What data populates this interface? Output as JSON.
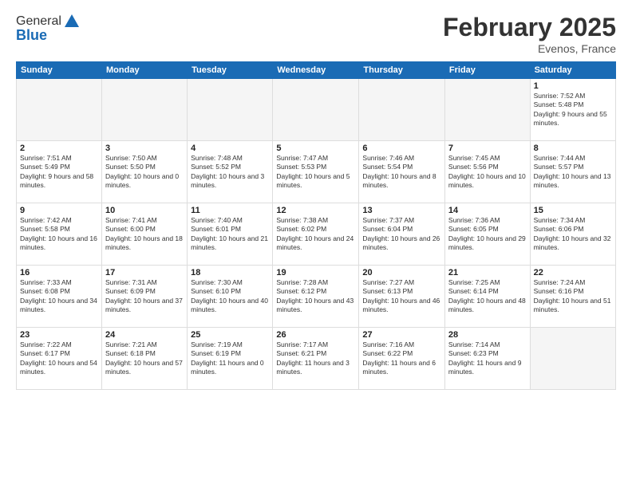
{
  "header": {
    "logo_line1": "General",
    "logo_line2": "Blue",
    "month": "February 2025",
    "location": "Evenos, France"
  },
  "weekdays": [
    "Sunday",
    "Monday",
    "Tuesday",
    "Wednesday",
    "Thursday",
    "Friday",
    "Saturday"
  ],
  "weeks": [
    [
      {
        "day": "",
        "info": ""
      },
      {
        "day": "",
        "info": ""
      },
      {
        "day": "",
        "info": ""
      },
      {
        "day": "",
        "info": ""
      },
      {
        "day": "",
        "info": ""
      },
      {
        "day": "",
        "info": ""
      },
      {
        "day": "1",
        "info": "Sunrise: 7:52 AM\nSunset: 5:48 PM\nDaylight: 9 hours and 55 minutes."
      }
    ],
    [
      {
        "day": "2",
        "info": "Sunrise: 7:51 AM\nSunset: 5:49 PM\nDaylight: 9 hours and 58 minutes."
      },
      {
        "day": "3",
        "info": "Sunrise: 7:50 AM\nSunset: 5:50 PM\nDaylight: 10 hours and 0 minutes."
      },
      {
        "day": "4",
        "info": "Sunrise: 7:48 AM\nSunset: 5:52 PM\nDaylight: 10 hours and 3 minutes."
      },
      {
        "day": "5",
        "info": "Sunrise: 7:47 AM\nSunset: 5:53 PM\nDaylight: 10 hours and 5 minutes."
      },
      {
        "day": "6",
        "info": "Sunrise: 7:46 AM\nSunset: 5:54 PM\nDaylight: 10 hours and 8 minutes."
      },
      {
        "day": "7",
        "info": "Sunrise: 7:45 AM\nSunset: 5:56 PM\nDaylight: 10 hours and 10 minutes."
      },
      {
        "day": "8",
        "info": "Sunrise: 7:44 AM\nSunset: 5:57 PM\nDaylight: 10 hours and 13 minutes."
      }
    ],
    [
      {
        "day": "9",
        "info": "Sunrise: 7:42 AM\nSunset: 5:58 PM\nDaylight: 10 hours and 16 minutes."
      },
      {
        "day": "10",
        "info": "Sunrise: 7:41 AM\nSunset: 6:00 PM\nDaylight: 10 hours and 18 minutes."
      },
      {
        "day": "11",
        "info": "Sunrise: 7:40 AM\nSunset: 6:01 PM\nDaylight: 10 hours and 21 minutes."
      },
      {
        "day": "12",
        "info": "Sunrise: 7:38 AM\nSunset: 6:02 PM\nDaylight: 10 hours and 24 minutes."
      },
      {
        "day": "13",
        "info": "Sunrise: 7:37 AM\nSunset: 6:04 PM\nDaylight: 10 hours and 26 minutes."
      },
      {
        "day": "14",
        "info": "Sunrise: 7:36 AM\nSunset: 6:05 PM\nDaylight: 10 hours and 29 minutes."
      },
      {
        "day": "15",
        "info": "Sunrise: 7:34 AM\nSunset: 6:06 PM\nDaylight: 10 hours and 32 minutes."
      }
    ],
    [
      {
        "day": "16",
        "info": "Sunrise: 7:33 AM\nSunset: 6:08 PM\nDaylight: 10 hours and 34 minutes."
      },
      {
        "day": "17",
        "info": "Sunrise: 7:31 AM\nSunset: 6:09 PM\nDaylight: 10 hours and 37 minutes."
      },
      {
        "day": "18",
        "info": "Sunrise: 7:30 AM\nSunset: 6:10 PM\nDaylight: 10 hours and 40 minutes."
      },
      {
        "day": "19",
        "info": "Sunrise: 7:28 AM\nSunset: 6:12 PM\nDaylight: 10 hours and 43 minutes."
      },
      {
        "day": "20",
        "info": "Sunrise: 7:27 AM\nSunset: 6:13 PM\nDaylight: 10 hours and 46 minutes."
      },
      {
        "day": "21",
        "info": "Sunrise: 7:25 AM\nSunset: 6:14 PM\nDaylight: 10 hours and 48 minutes."
      },
      {
        "day": "22",
        "info": "Sunrise: 7:24 AM\nSunset: 6:16 PM\nDaylight: 10 hours and 51 minutes."
      }
    ],
    [
      {
        "day": "23",
        "info": "Sunrise: 7:22 AM\nSunset: 6:17 PM\nDaylight: 10 hours and 54 minutes."
      },
      {
        "day": "24",
        "info": "Sunrise: 7:21 AM\nSunset: 6:18 PM\nDaylight: 10 hours and 57 minutes."
      },
      {
        "day": "25",
        "info": "Sunrise: 7:19 AM\nSunset: 6:19 PM\nDaylight: 11 hours and 0 minutes."
      },
      {
        "day": "26",
        "info": "Sunrise: 7:17 AM\nSunset: 6:21 PM\nDaylight: 11 hours and 3 minutes."
      },
      {
        "day": "27",
        "info": "Sunrise: 7:16 AM\nSunset: 6:22 PM\nDaylight: 11 hours and 6 minutes."
      },
      {
        "day": "28",
        "info": "Sunrise: 7:14 AM\nSunset: 6:23 PM\nDaylight: 11 hours and 9 minutes."
      },
      {
        "day": "",
        "info": ""
      }
    ]
  ]
}
